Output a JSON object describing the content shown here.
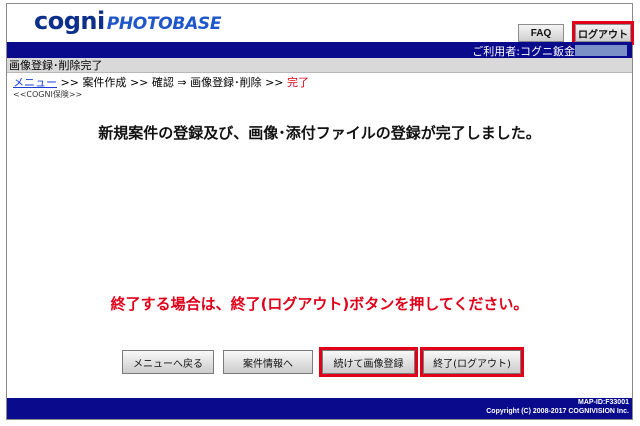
{
  "brand": {
    "cogni": "cogni",
    "photobase": "PHOTOBASE"
  },
  "header": {
    "faq_label": "FAQ",
    "logout_label": "ログアウト",
    "user_label": "ご利用者:コグニ鈑金"
  },
  "page": {
    "title": "画像登録･削除完了"
  },
  "breadcrumb": {
    "menu": "メニュー",
    "sep1": ">>",
    "case_create": "案件作成",
    "sep2": ">>",
    "confirm": "確認",
    "sep3": "⇒",
    "image_reg": "画像登録･削除",
    "sep4": ">>",
    "complete": "完了"
  },
  "sub_note": "<<COGNI保険>>",
  "main": {
    "complete_message": "新規案件の登録及び、画像･添付ファイルの登録が完了しました。",
    "instruction": "終了する場合は、終了(ログアウト)ボタンを押してください。"
  },
  "actions": {
    "back_to_menu": "メニューへ戻る",
    "case_info": "案件情報へ",
    "continue_image": "続けて画像登録",
    "exit_logout": "終了(ログアウト)"
  },
  "footer": {
    "map_id": "MAP-ID:F33001",
    "copyright": "Copyright (C) 2008-2017 COGNIVISION Inc."
  },
  "colors": {
    "navy_bar": "#0a0a8c",
    "highlight_red": "#e0001a",
    "link_blue": "#1a3fd1",
    "logo_dark": "#0d2f8c",
    "logo_light": "#1f56c9"
  }
}
